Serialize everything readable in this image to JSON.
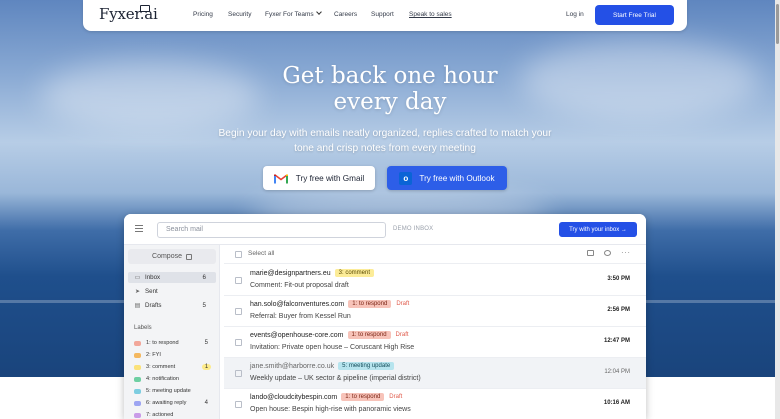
{
  "nav": {
    "logo": "Fyxer.ai",
    "links": [
      "Pricing",
      "Security",
      "Fyxer For Teams",
      "Careers",
      "Support",
      "Speak to sales"
    ],
    "login": "Log in",
    "cta": "Start Free Trial"
  },
  "hero": {
    "title_line1": "Get back one hour",
    "title_line2": "every day",
    "subtitle_line1": "Begin your day with emails neatly organized, replies crafted to match your",
    "subtitle_line2": "tone and crisp notes from every meeting",
    "gmail_button": "Try free with Gmail",
    "outlook_button": "Try free with Outlook"
  },
  "app": {
    "search_placeholder": "Search mail",
    "demo_label": "DEMO INBOX",
    "try_button": "Try with your inbox →",
    "compose": "Compose",
    "folders": [
      {
        "name": "Inbox",
        "count": "6",
        "icon": "inbox-icon"
      },
      {
        "name": "Sent",
        "count": "",
        "icon": "send-icon"
      },
      {
        "name": "Drafts",
        "count": "5",
        "icon": "draft-icon"
      }
    ],
    "labels_title": "Labels",
    "labels": [
      {
        "name": "1: to respond",
        "count": "5",
        "color": "#f2a79a"
      },
      {
        "name": "2: FYI",
        "count": "",
        "color": "#f4b860"
      },
      {
        "name": "3: comment",
        "count": "1",
        "color": "#fbe27a"
      },
      {
        "name": "4: notification",
        "count": "",
        "color": "#6ecfa2"
      },
      {
        "name": "5: meeting update",
        "count": "",
        "color": "#7dcde0"
      },
      {
        "name": "6: awaiting reply",
        "count": "4",
        "color": "#9da5f2"
      },
      {
        "name": "7: actioned",
        "count": "",
        "color": "#c99be8"
      }
    ],
    "select_all": "Select all",
    "emails": [
      {
        "sender": "marie@designpartners.eu",
        "tag": "3: comment",
        "tag_bg": "#fcec98",
        "tag_fg": "#5a4a00",
        "draft": "",
        "subject": "Comment: Fit-out proposal draft",
        "time": "3:50 PM"
      },
      {
        "sender": "han.solo@falconventures.com",
        "tag": "1: to respond",
        "tag_bg": "#f7c3b9",
        "tag_fg": "#7a2414",
        "draft": "Draft",
        "subject": "Referral: Buyer from Kessel Run",
        "time": "2:56 PM"
      },
      {
        "sender": "events@openhouse-core.com",
        "tag": "1: to respond",
        "tag_bg": "#f7c3b9",
        "tag_fg": "#7a2414",
        "draft": "Draft",
        "subject": "Invitation: Private open house – Coruscant High Rise",
        "time": "12:47 PM"
      },
      {
        "sender": "jane.smith@harborre.co.uk",
        "tag": "5: meeting update",
        "tag_bg": "#b6e4ee",
        "tag_fg": "#134b58",
        "draft": "",
        "subject": "Weekly update – UK sector & pipeline (imperial district)",
        "time": "12:04 PM"
      },
      {
        "sender": "lando@cloudcitybespin.com",
        "tag": "1: to respond",
        "tag_bg": "#f7c3b9",
        "tag_fg": "#7a2414",
        "draft": "Draft",
        "subject": "Open house: Bespin high-rise with panoramic views",
        "time": "10:16 AM"
      }
    ]
  }
}
